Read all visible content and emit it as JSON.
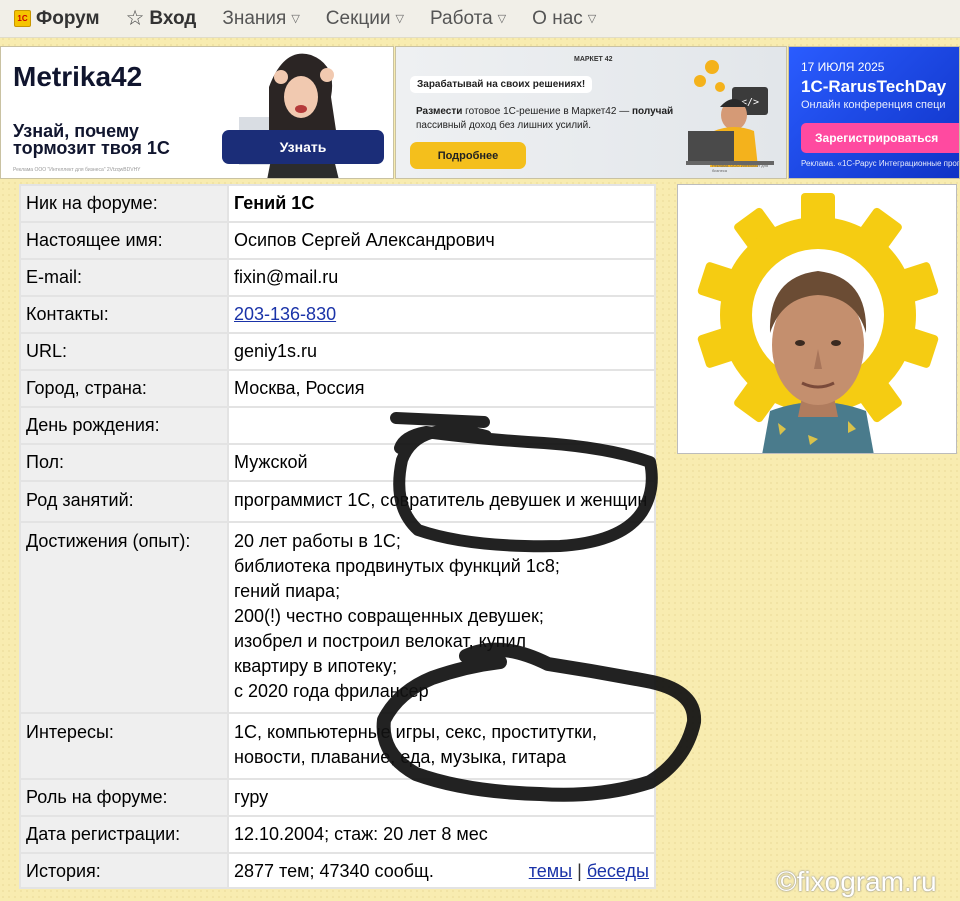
{
  "nav": {
    "forum_logo": "1С",
    "forum": "Форум",
    "login": "Вход",
    "items": [
      "Знания",
      "Секции",
      "Работа",
      "О нас"
    ]
  },
  "banners": {
    "b1": {
      "title": "Metrika42",
      "text": "Узнай, почему тормозит твоя 1С",
      "button": "Узнать",
      "fine": "Реклама ООО \"Интеллект для бизнеса\" 2VtzqwBDVHY"
    },
    "b2": {
      "brand": "МАРКЕТ 42",
      "pill": "Зарабатывай на своих решениях!",
      "text_bold1": "Размести",
      "text_mid": " готовое 1С-решение в Маркет42 — ",
      "text_bold2": "получай",
      "text_end": " пассивный доход без лишних усилий.",
      "button": "Подробнее",
      "fine": "Реклама. ООО Интеллект для бизнеса"
    },
    "b3": {
      "date": "17 ИЮЛЯ 2025",
      "title": "1C-RarusTechDay",
      "sub": "Онлайн конференция специ",
      "button": "Зарегистрироваться",
      "fine": "Реклама. «1С-Рарус Интеграционные прог"
    }
  },
  "profile": {
    "rows": [
      {
        "label": "Ник на форуме:",
        "value": "Гений 1С"
      },
      {
        "label": "Настоящее имя:",
        "value": "Осипов Сергей Александрович"
      },
      {
        "label": "E-mail:",
        "value": "fixin@mail.ru"
      },
      {
        "label": "Контакты:",
        "value": "203-136-830"
      },
      {
        "label": "URL:",
        "value": "geniy1s.ru"
      },
      {
        "label": "Город, страна:",
        "value": "Москва, Россия"
      },
      {
        "label": "День рождения:",
        "value": ""
      },
      {
        "label": "Пол:",
        "value": "Мужской"
      },
      {
        "label": "Род занятий:",
        "value": "программист 1С, совратитель девушек и женщин"
      },
      {
        "label": "Достижения (опыт):",
        "lines": [
          "20 лет работы в 1С;",
          "библиотека продвинутых функций 1с8;",
          "гений пиара;",
          "200(!) честно совращенных девушек;",
          "изобрел и построил велокат, купил",
          "квартиру в ипотеку;",
          "с 2020 года фрилансер"
        ]
      },
      {
        "label": "Интересы:",
        "value": "1С, компьютерные игры, секс, проститутки, новости, плавание, еда, музыка, гитара"
      },
      {
        "label": "Роль на форуме:",
        "value": "гуру"
      },
      {
        "label": "Дата регистрации:",
        "value": "12.10.2004; стаж: 20 лет 8 мес"
      },
      {
        "label": "История:",
        "value": "2877 тем; 47340 сообщ.",
        "link_topics": "темы",
        "separator": "|",
        "link_talks": "беседы"
      }
    ]
  },
  "watermark": "©fixogram.ru"
}
